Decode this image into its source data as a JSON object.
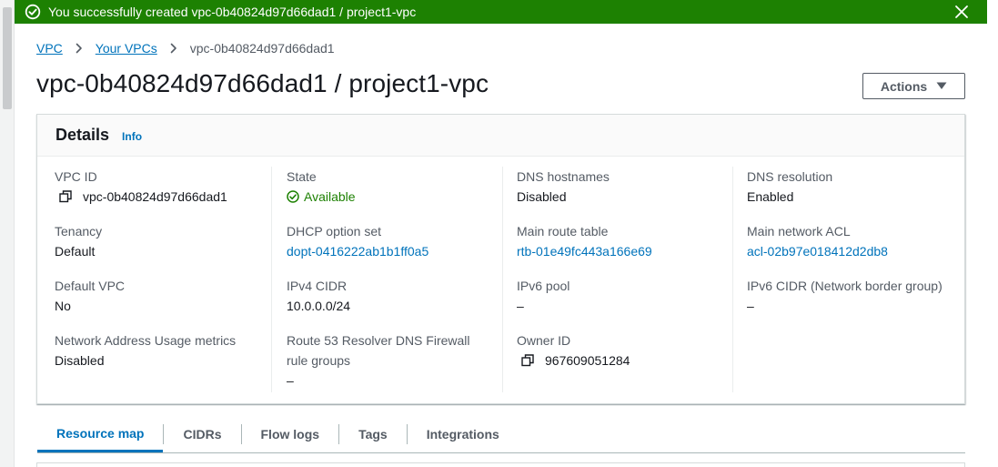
{
  "flash": {
    "message": "You successfully created vpc-0b40824d97d66dad1 / project1-vpc",
    "icon": "check-circle-icon",
    "close_icon": "close-icon",
    "color": "#1d8102"
  },
  "breadcrumb": {
    "items": [
      "VPC",
      "Your VPCs"
    ],
    "current": "vpc-0b40824d97d66dad1"
  },
  "page": {
    "title": "vpc-0b40824d97d66dad1 / project1-vpc",
    "actions_label": "Actions"
  },
  "details": {
    "title": "Details",
    "info_link": "Info",
    "fields": {
      "vpc_id": {
        "label": "VPC ID",
        "value": "vpc-0b40824d97d66dad1"
      },
      "state": {
        "label": "State",
        "value": "Available"
      },
      "dns_hostnames": {
        "label": "DNS hostnames",
        "value": "Disabled"
      },
      "dns_resolution": {
        "label": "DNS resolution",
        "value": "Enabled"
      },
      "tenancy": {
        "label": "Tenancy",
        "value": "Default"
      },
      "dhcp_option_set": {
        "label": "DHCP option set",
        "value": "dopt-0416222ab1b1ff0a5"
      },
      "main_route_table": {
        "label": "Main route table",
        "value": "rtb-01e49fc443a166e69"
      },
      "main_network_acl": {
        "label": "Main network ACL",
        "value": "acl-02b97e018412d2db8"
      },
      "default_vpc": {
        "label": "Default VPC",
        "value": "No"
      },
      "ipv4_cidr": {
        "label": "IPv4 CIDR",
        "value": "10.0.0.0/24"
      },
      "ipv6_pool": {
        "label": "IPv6 pool",
        "value": "–"
      },
      "ipv6_cidr": {
        "label": "IPv6 CIDR (Network border group)",
        "value": "–"
      },
      "nau_metrics": {
        "label": "Network Address Usage metrics",
        "value": "Disabled"
      },
      "dns_firewall": {
        "label_line1": "Route 53 Resolver DNS Firewall",
        "label_line2": "rule groups",
        "value": "–"
      },
      "owner_id": {
        "label": "Owner ID",
        "value": "967609051284"
      }
    }
  },
  "tabs": [
    "Resource map",
    "CIDRs",
    "Flow logs",
    "Tags",
    "Integrations"
  ],
  "colors": {
    "link": "#0073bb",
    "success": "#1d8102",
    "text": "#16191f",
    "muted": "#545b64"
  }
}
